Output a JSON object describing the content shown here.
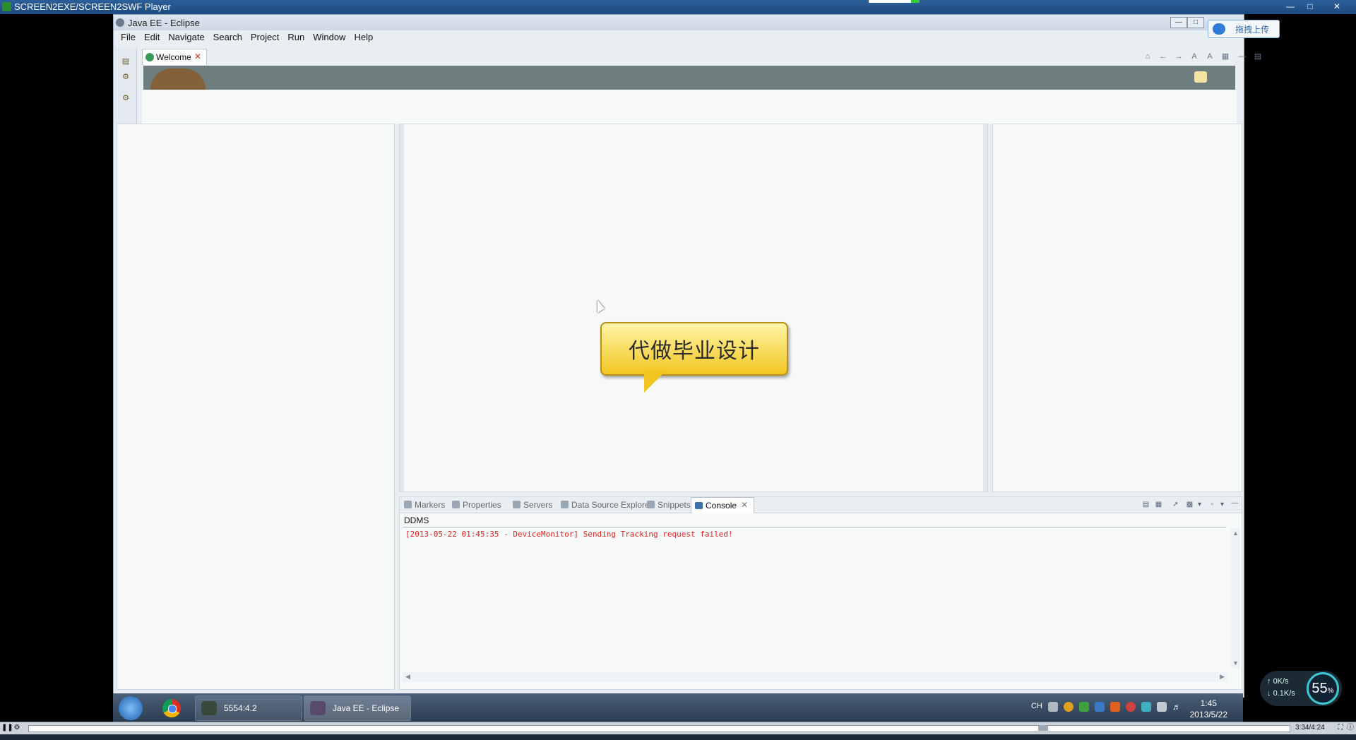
{
  "player": {
    "title": "SCREEN2EXE/SCREEN2SWF Player",
    "time": "3:34/4:24"
  },
  "eclipse": {
    "title": "Java EE - Eclipse",
    "menu": [
      "File",
      "Edit",
      "Navigate",
      "Search",
      "Project",
      "Run",
      "Window",
      "Help"
    ],
    "welcome_tab": "Welcome"
  },
  "console": {
    "tabs": [
      "Markers",
      "Properties",
      "Servers",
      "Data Source Explorer",
      "Snippets"
    ],
    "active_tab": "Console",
    "name": "DDMS",
    "text": "[2013-05-22 01:45:35 - DeviceMonitor] Sending Tracking request failed!"
  },
  "bubble": {
    "text": "代做毕业设计"
  },
  "upload_button": {
    "label": "拖拽上传"
  },
  "net_speed": {
    "up": "0K/s",
    "down": "0.1K/s",
    "percent": "55",
    "percent_unit": "%"
  },
  "taskbar": {
    "items": [
      {
        "label": "5554:4.2"
      },
      {
        "label": "Java EE - Eclipse"
      }
    ],
    "lang": "CH",
    "clock_time": "1:45",
    "clock_date": "2013/5/22"
  },
  "colors": {
    "console_error": "#e02020",
    "bubble_fill": "#f2c520",
    "banner": "#6e7e7e"
  }
}
